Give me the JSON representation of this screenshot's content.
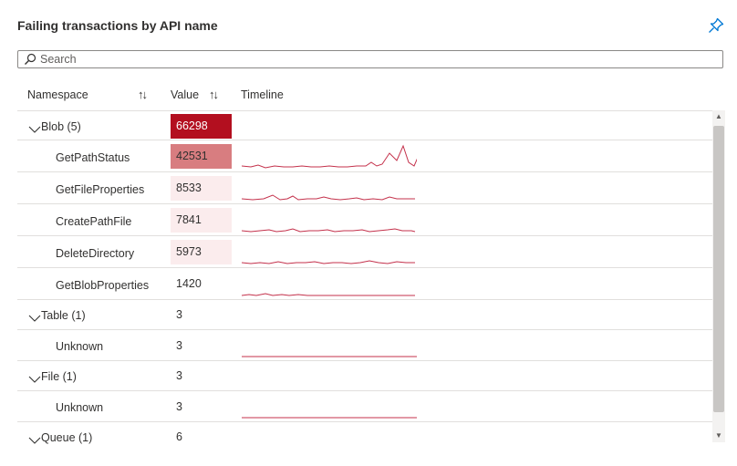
{
  "panel": {
    "title": "Failing transactions by API name"
  },
  "search": {
    "placeholder": "Search"
  },
  "columns": {
    "namespace": "Namespace",
    "value": "Value",
    "timeline": "Timeline"
  },
  "rows": [
    {
      "name": "Blob (5)",
      "value": "66298",
      "group": true
    },
    {
      "name": "GetPathStatus",
      "value": "42531",
      "group": false
    },
    {
      "name": "GetFileProperties",
      "value": "8533",
      "group": false
    },
    {
      "name": "CreatePathFile",
      "value": "7841",
      "group": false
    },
    {
      "name": "DeleteDirectory",
      "value": "5973",
      "group": false
    },
    {
      "name": "GetBlobProperties",
      "value": "1420",
      "group": false
    },
    {
      "name": "Table (1)",
      "value": "3",
      "group": true
    },
    {
      "name": "Unknown",
      "value": "3",
      "group": false
    },
    {
      "name": "File (1)",
      "value": "3",
      "group": true
    },
    {
      "name": "Unknown",
      "value": "3",
      "group": false
    },
    {
      "name": "Queue (1)",
      "value": "6",
      "group": true
    }
  ],
  "colors": {
    "heat_high": "#b30f1f",
    "heat_mid": "#d87d80",
    "heat_low": "#fbeced",
    "spark": "#c4314b",
    "pin": "#0078d4"
  },
  "icons": {
    "pin": "pin-icon",
    "search": "search-icon",
    "expand": "chevron-down-icon",
    "sort": "sort-arrows-icon"
  }
}
